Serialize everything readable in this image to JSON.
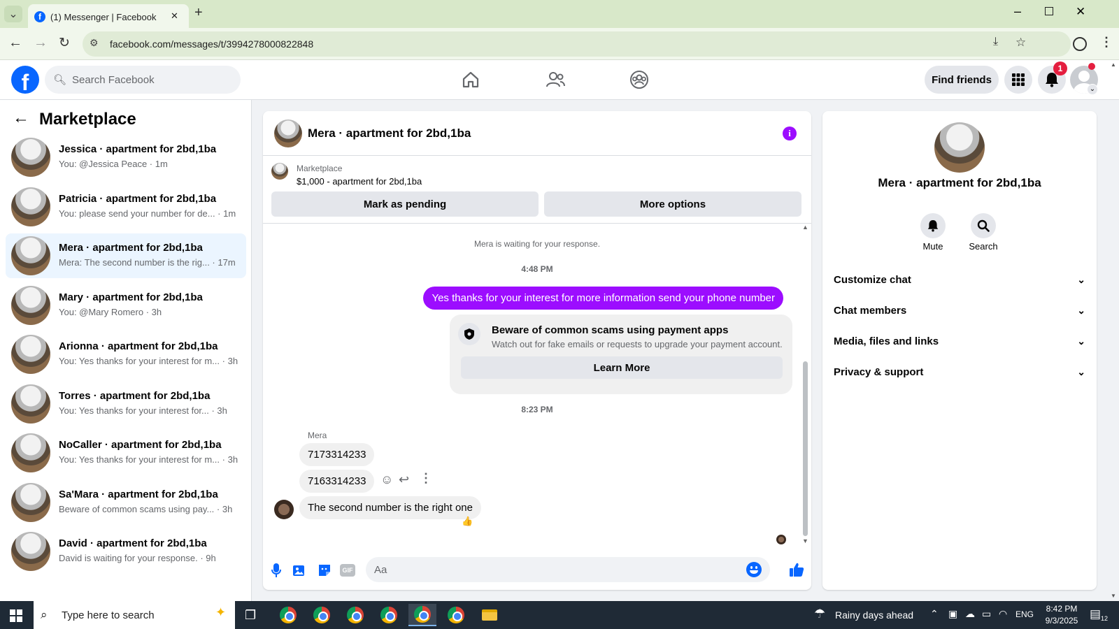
{
  "browser": {
    "tab_title": "(1) Messenger | Facebook",
    "url": "facebook.com/messages/t/3994278000822848",
    "new_tab": "+",
    "close_tab": "✕"
  },
  "fb_header": {
    "search_placeholder": "Search Facebook",
    "find_friends": "Find friends",
    "notification_count": "1"
  },
  "left": {
    "title": "Marketplace",
    "conversations": [
      {
        "name": "Jessica · apartment for 2bd,1ba",
        "preview": "You: @Jessica Peace · 1m",
        "active": false
      },
      {
        "name": "Patricia · apartment for 2bd,1ba",
        "preview": "You: please send your number for de... · 1m",
        "active": false
      },
      {
        "name": "Mera · apartment for 2bd,1ba",
        "preview": "Mera: The second number is the rig... · 17m",
        "active": true
      },
      {
        "name": "Mary · apartment for 2bd,1ba",
        "preview": "You: @Mary Romero · 3h",
        "active": false
      },
      {
        "name": "Arionna · apartment for 2bd,1ba",
        "preview": "You: Yes thanks for your interest for m... · 3h",
        "active": false
      },
      {
        "name": "Torres · apartment for 2bd,1ba",
        "preview": "You: Yes thanks for your interest for... · 3h",
        "active": false
      },
      {
        "name": "NoCaller · apartment for 2bd,1ba",
        "preview": "You: Yes thanks for your interest for m... · 3h",
        "active": false
      },
      {
        "name": "Sa'Mara · apartment for 2bd,1ba",
        "preview": "Beware of common scams using pay... · 3h",
        "active": false
      },
      {
        "name": "David · apartment for 2bd,1ba",
        "preview": "David is waiting for your response. · 9h",
        "active": false
      }
    ]
  },
  "chat": {
    "title": "Mera · apartment for 2bd,1ba",
    "listing_label": "Marketplace",
    "listing_price": "$1,000 - apartment for 2bd,1ba",
    "mark_pending": "Mark as pending",
    "more_options": "More options",
    "waiting_note": "Mera is waiting for your response.",
    "time1": "4:48 PM",
    "outgoing_msg": "Yes thanks for your interest for more information send your phone number",
    "scam_title": "Beware of common scams using payment apps",
    "scam_body": "Watch out for fake emails or requests to upgrade your payment account.",
    "learn_more": "Learn More",
    "time2": "8:23 PM",
    "sender": "Mera",
    "msg1": "7173314233",
    "msg2": "7163314233",
    "msg3": "The second number is the right one",
    "reaction": "👍",
    "composer_placeholder": "Aa"
  },
  "right": {
    "title": "Mera · apartment for 2bd,1ba",
    "mute": "Mute",
    "search": "Search",
    "sections": [
      "Customize chat",
      "Chat members",
      "Media, files and links",
      "Privacy & support"
    ]
  },
  "taskbar": {
    "search_placeholder": "Type here to search",
    "weather": "Rainy days ahead",
    "lang": "ENG",
    "time": "8:42 PM",
    "date": "9/3/2025",
    "notif_count": "12"
  },
  "colors": {
    "accent": "#9c0dff",
    "fb_blue": "#0866ff"
  }
}
